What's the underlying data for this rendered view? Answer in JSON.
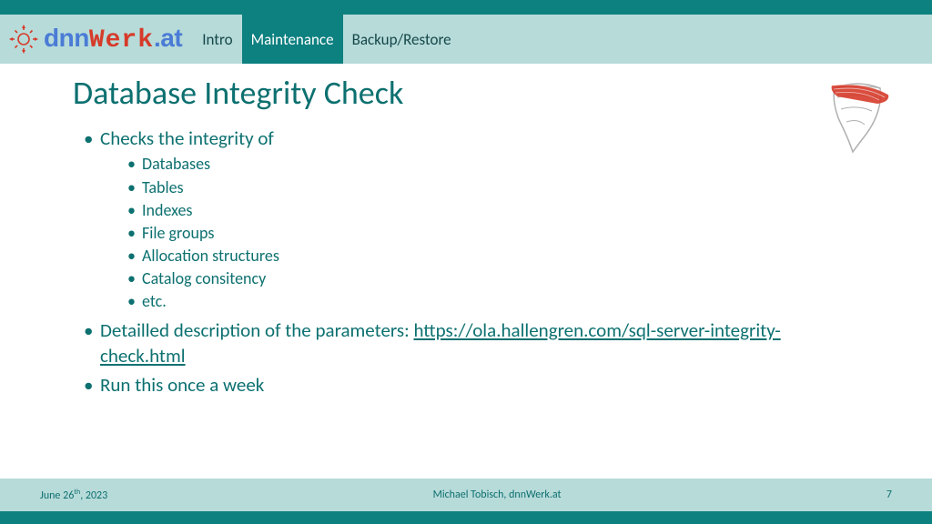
{
  "logo": {
    "part1": "dnn",
    "part2": "Werk",
    "part3": ".at"
  },
  "nav": {
    "tabs": [
      {
        "label": "Intro",
        "active": false
      },
      {
        "label": "Maintenance",
        "active": true
      },
      {
        "label": "Backup/Restore",
        "active": false
      }
    ]
  },
  "slide": {
    "title": "Database Integrity Check",
    "bullets": {
      "b1": "Checks the integrity of",
      "sub": {
        "s1": "Databases",
        "s2": "Tables",
        "s3": "Indexes",
        "s4": "File groups",
        "s5": "Allocation structures",
        "s6": "Catalog consitency",
        "s7": "etc."
      },
      "b2_prefix": "Detailled description of the parameters: ",
      "b2_link": "https://ola.hallengren.com/sql-server-integrity-check.html",
      "b3": "Run this once a week"
    }
  },
  "footer": {
    "date_prefix": "June 26",
    "date_ord": "th",
    "date_suffix": ", 2023",
    "author": "Michael Tobisch, dnnWerk.at",
    "page": "7"
  }
}
